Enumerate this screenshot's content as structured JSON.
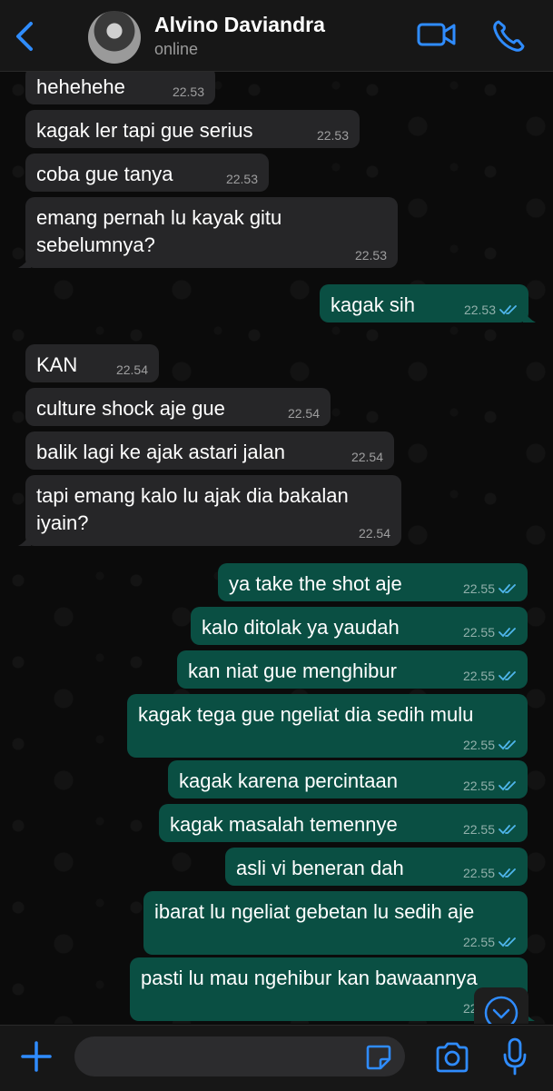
{
  "header": {
    "name": "Alvino Daviandra",
    "status": "online"
  },
  "messages": [
    {
      "dir": "in",
      "text": "hehehehe",
      "time": "22.53"
    },
    {
      "dir": "in",
      "text": "kagak ler tapi gue serius",
      "time": "22.53"
    },
    {
      "dir": "in",
      "text": "coba gue tanya",
      "time": "22.53"
    },
    {
      "dir": "in",
      "lines": [
        "emang pernah lu kayak gitu",
        "sebelumnya?"
      ],
      "time": "22.53"
    },
    {
      "dir": "out",
      "text": "kagak sih",
      "time": "22.53"
    },
    {
      "dir": "in",
      "text": "KAN",
      "time": "22.54"
    },
    {
      "dir": "in",
      "text": "culture shock aje gue",
      "time": "22.54"
    },
    {
      "dir": "in",
      "text": "balik lagi ke ajak astari jalan",
      "time": "22.54"
    },
    {
      "dir": "in",
      "lines": [
        "tapi emang kalo lu ajak dia bakalan",
        "iyain?"
      ],
      "time": "22.54"
    },
    {
      "dir": "out",
      "text": "ya take the shot aje",
      "time": "22.55"
    },
    {
      "dir": "out",
      "text": "kalo ditolak ya yaudah",
      "time": "22.55"
    },
    {
      "dir": "out",
      "text": "kan niat gue menghibur",
      "time": "22.55"
    },
    {
      "dir": "out",
      "text": "kagak tega gue ngeliat dia sedih mulu",
      "time": "22.55"
    },
    {
      "dir": "out",
      "text": "kagak karena percintaan",
      "time": "22.55"
    },
    {
      "dir": "out",
      "text": "kagak masalah temennye",
      "time": "22.55"
    },
    {
      "dir": "out",
      "text": "asli vi beneran dah",
      "time": "22.55"
    },
    {
      "dir": "out",
      "text": "ibarat lu ngeliat gebetan lu sedih aje",
      "time": "22.55"
    },
    {
      "dir": "out",
      "text": "pasti lu mau ngehibur kan bawaannya",
      "time": "22.56"
    }
  ],
  "composer": {
    "placeholder": ""
  },
  "icons": [
    "back-chevron-icon",
    "video-call-icon",
    "phone-icon",
    "double-check-icon",
    "chevron-down-icon",
    "plus-icon",
    "sticker-icon",
    "camera-icon",
    "microphone-icon"
  ],
  "colors": {
    "accent": "#2f8cff",
    "incoming": "#262628",
    "outgoing": "#0a4f43",
    "read_ticks": "#4fb6ec"
  }
}
